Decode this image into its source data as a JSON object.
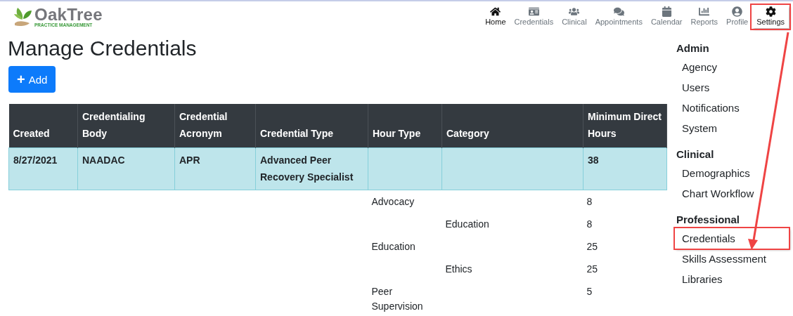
{
  "logo": {
    "name": "OakTree",
    "tagline": "PRACTICE MANAGEMENT"
  },
  "nav": [
    {
      "label": "Home",
      "active": true,
      "highlighted": false
    },
    {
      "label": "Credentials",
      "active": false,
      "highlighted": false
    },
    {
      "label": "Clinical",
      "active": false,
      "highlighted": false
    },
    {
      "label": "Appointments",
      "active": false,
      "highlighted": false
    },
    {
      "label": "Calendar",
      "active": false,
      "highlighted": false
    },
    {
      "label": "Reports",
      "active": false,
      "highlighted": false
    },
    {
      "label": "Profile",
      "active": false,
      "highlighted": false
    },
    {
      "label": "Settings",
      "active": true,
      "highlighted": true
    }
  ],
  "page_title": "Manage Credentials",
  "add_button": {
    "icon": "+",
    "label": "Add"
  },
  "table": {
    "columns": [
      "Created",
      "Credentialing Body",
      "Credential Acronym",
      "Credential Type",
      "Hour Type",
      "Category",
      "Minimum Direct Hours"
    ],
    "rows": [
      {
        "kind": "credential",
        "cells": [
          "8/27/2021",
          "NAADAC",
          "APR",
          "Advanced Peer Recovery Specialist",
          "",
          "",
          "38"
        ]
      },
      {
        "kind": "hours",
        "cells": [
          "",
          "",
          "",
          "",
          "Advocacy",
          "",
          "8"
        ]
      },
      {
        "kind": "hours",
        "cells": [
          "",
          "",
          "",
          "",
          "",
          "Education",
          "8"
        ]
      },
      {
        "kind": "hours",
        "cells": [
          "",
          "",
          "",
          "",
          "Education",
          "",
          "25"
        ]
      },
      {
        "kind": "hours",
        "cells": [
          "",
          "",
          "",
          "",
          "",
          "Ethics",
          "25"
        ]
      },
      {
        "kind": "hours",
        "cells": [
          "",
          "",
          "",
          "",
          "Peer Supervision",
          "",
          "5"
        ]
      }
    ]
  },
  "settings_menu": [
    {
      "heading": "Admin",
      "items": [
        {
          "label": "Agency",
          "highlighted": false
        },
        {
          "label": "Users",
          "highlighted": false
        },
        {
          "label": "Notifications",
          "highlighted": false
        },
        {
          "label": "System",
          "highlighted": false
        }
      ]
    },
    {
      "heading": "Clinical",
      "items": [
        {
          "label": "Demographics",
          "highlighted": false
        },
        {
          "label": "Chart Workflow",
          "highlighted": false
        }
      ]
    },
    {
      "heading": "Professional",
      "items": [
        {
          "label": "Credentials",
          "highlighted": true
        },
        {
          "label": "Skills Assessment",
          "highlighted": false
        },
        {
          "label": "Libraries",
          "highlighted": false
        }
      ]
    }
  ]
}
